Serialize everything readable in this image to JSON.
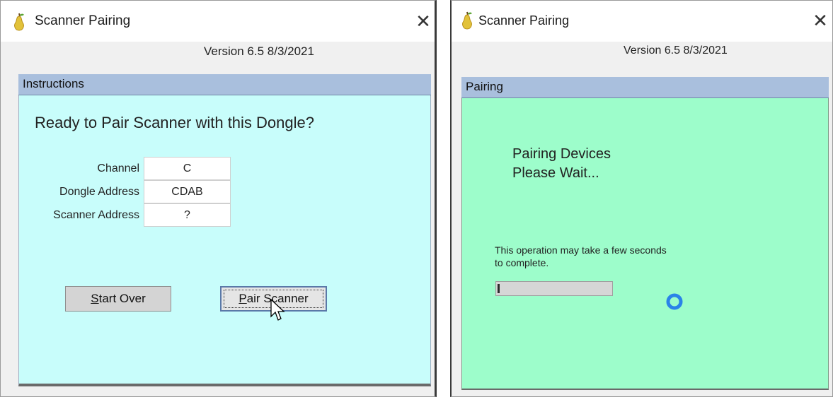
{
  "left_window": {
    "title": "Scanner Pairing",
    "close_glyph": "✕",
    "version": "Version 6.5 8/3/2021",
    "panel_header": "Instructions",
    "heading": "Ready to Pair Scanner with this Dongle?",
    "fields": [
      {
        "label": "Channel",
        "value": "C"
      },
      {
        "label": "Dongle Address",
        "value": "CDAB"
      },
      {
        "label": "Scanner Address",
        "value": "?"
      }
    ],
    "buttons": {
      "start_over": {
        "mnemonic": "S",
        "rest": "tart Over"
      },
      "pair_scanner": {
        "mnemonic": "P",
        "rest": "air Scanner"
      }
    },
    "panel_color": "#c8fdfb"
  },
  "right_window": {
    "title": "Scanner Pairing",
    "close_glyph": "✕",
    "version": "Version 6.5 8/3/2021",
    "panel_header": "Pairing",
    "message_line1": "Pairing Devices",
    "message_line2": "Please Wait...",
    "note_line1": "This operation may take a few seconds",
    "note_line2": "to complete.",
    "progress_fraction": 0.02,
    "panel_color": "#9dfdcb",
    "spinner_color": "#2a83e8"
  },
  "cursor_icon": "arrow-cursor-icon"
}
